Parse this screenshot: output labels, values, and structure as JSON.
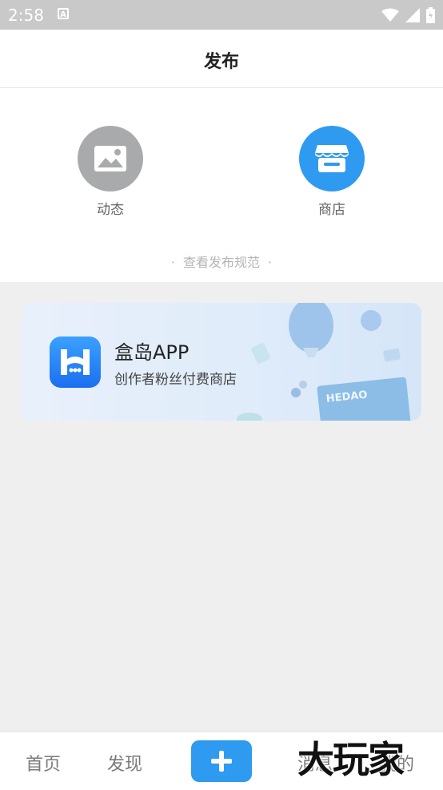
{
  "status_bar": {
    "time": "2:58",
    "notification_icon": "a-letter-icon",
    "right_icons": [
      "wifi-icon",
      "signal-icon",
      "battery-icon"
    ]
  },
  "header": {
    "title": "发布"
  },
  "publish_options": [
    {
      "label": "动态",
      "icon": "image-icon",
      "color": "#a9aaac"
    },
    {
      "label": "商店",
      "icon": "store-icon",
      "color": "#2e9bf0"
    }
  ],
  "rules_link": {
    "label": "查看发布规范"
  },
  "banner": {
    "title": "盒岛APP",
    "subtitle": "创作者粉丝付费商店",
    "box_label": "HEDAO"
  },
  "tabbar": {
    "items": [
      {
        "label": "首页"
      },
      {
        "label": "发现"
      },
      {
        "label": "消息"
      },
      {
        "label": "我的"
      }
    ],
    "publish_icon": "plus-icon",
    "accent": "#2e9bf0"
  },
  "watermark": {
    "text": "大玩家"
  }
}
